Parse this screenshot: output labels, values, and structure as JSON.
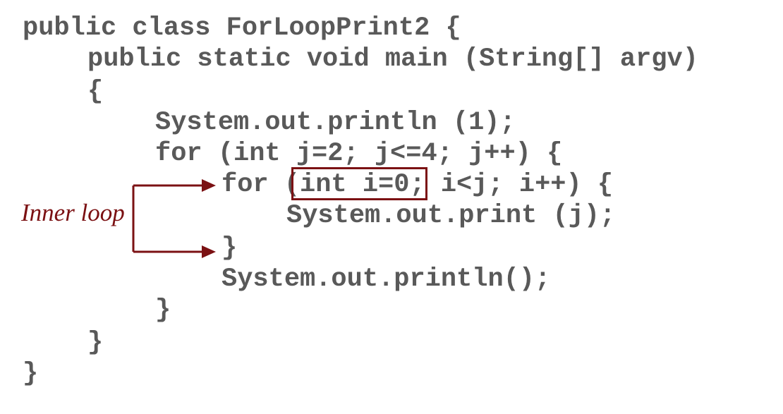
{
  "code": {
    "lines": [
      "public class ForLoopPrint2 {",
      "public static void main (String[] argv)",
      "{",
      "System.out.println (1);",
      "for (int j=2; j<=4; j++) {",
      "for (int i=0; i<j; i++) {",
      "System.out.print (j);",
      "}",
      "System.out.println();",
      "}",
      "}",
      "}"
    ]
  },
  "annotation": {
    "label": "Inner loop"
  },
  "colors": {
    "code_text": "#595959",
    "accent": "#7b1113"
  }
}
